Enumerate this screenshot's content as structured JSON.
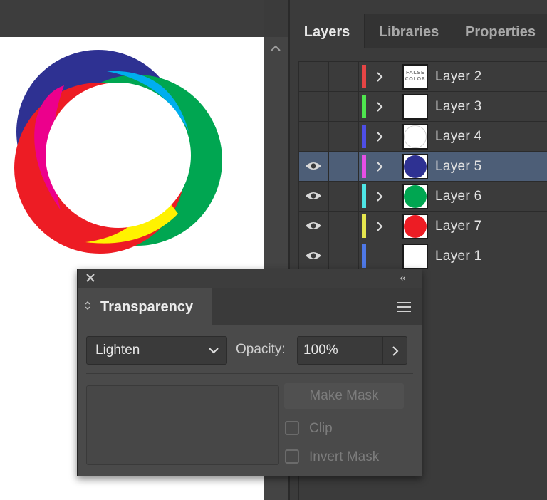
{
  "layers_panel": {
    "tabs": [
      {
        "label": "Layers",
        "active": true
      },
      {
        "label": "Libraries",
        "active": false
      },
      {
        "label": "Properties",
        "active": false
      }
    ],
    "layers": [
      {
        "name": "Layer 2",
        "visible": false,
        "color": "#e64545",
        "expandable": true,
        "thumbnail": "false-color-text",
        "thumb_text": "FALSE COLOR",
        "selected": false
      },
      {
        "name": "Layer 3",
        "visible": false,
        "color": "#4ee64e",
        "expandable": true,
        "thumbnail": "blank",
        "selected": false
      },
      {
        "name": "Layer 4",
        "visible": false,
        "color": "#4e4ee6",
        "expandable": true,
        "thumbnail": "white-circle",
        "selected": false
      },
      {
        "name": "Layer 5",
        "visible": true,
        "color": "#e64ee6",
        "expandable": true,
        "thumbnail": "circle",
        "thumb_color": "#2e3192",
        "selected": true
      },
      {
        "name": "Layer 6",
        "visible": true,
        "color": "#4ee6e6",
        "expandable": true,
        "thumbnail": "circle",
        "thumb_color": "#00a651",
        "selected": false
      },
      {
        "name": "Layer 7",
        "visible": true,
        "color": "#e6e64e",
        "expandable": true,
        "thumbnail": "circle",
        "thumb_color": "#ed1c24",
        "selected": false
      },
      {
        "name": "Layer 1",
        "visible": true,
        "color": "#4e78e6",
        "expandable": false,
        "thumbnail": "blank",
        "selected": false
      }
    ]
  },
  "artwork": {
    "colors": {
      "blue": "#2e3192",
      "cyan": "#00aeef",
      "green": "#00a651",
      "magenta": "#ec008c",
      "red": "#ed1c24",
      "yellow": "#fff200",
      "white": "#ffffff"
    }
  },
  "transparency_panel": {
    "title": "Transparency",
    "blend_mode": "Lighten",
    "opacity_label": "Opacity:",
    "opacity_value": "100%",
    "make_mask_label": "Make Mask",
    "clip_label": "Clip",
    "clip_checked": false,
    "invert_mask_label": "Invert Mask",
    "invert_mask_checked": false
  },
  "icons": {
    "close": "close-icon",
    "collapse": "collapse-panel-icon",
    "menu": "panel-menu-icon",
    "eye": "eye-icon",
    "expand": "chevron-right-icon",
    "dropdown": "chevron-down-icon",
    "scroll_up": "chevron-up-icon"
  }
}
